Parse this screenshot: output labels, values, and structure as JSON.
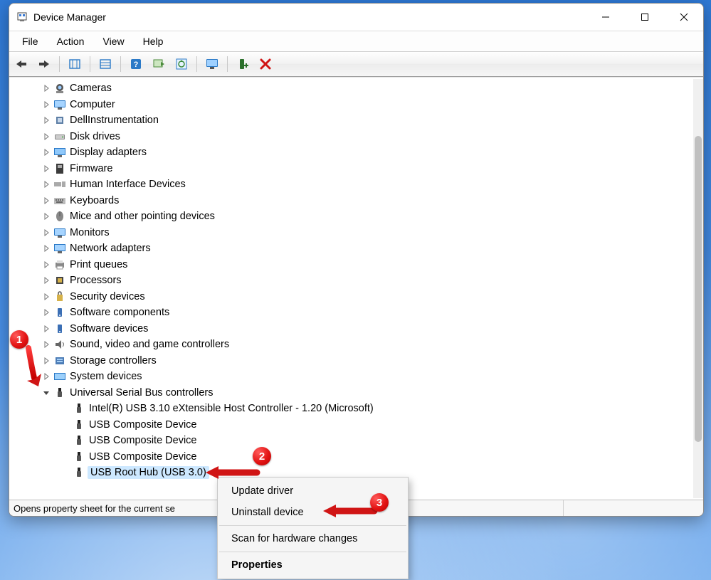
{
  "window": {
    "title": "Device Manager"
  },
  "menubar": [
    "File",
    "Action",
    "View",
    "Help"
  ],
  "toolbar_buttons": [
    {
      "name": "back"
    },
    {
      "name": "forward"
    },
    {
      "sep": true
    },
    {
      "name": "show-hidden"
    },
    {
      "sep": true
    },
    {
      "name": "properties"
    },
    {
      "sep": true
    },
    {
      "name": "help"
    },
    {
      "name": "scan"
    },
    {
      "name": "update"
    },
    {
      "sep": true
    },
    {
      "name": "monitor"
    },
    {
      "sep": true
    },
    {
      "name": "add-device"
    },
    {
      "name": "remove"
    }
  ],
  "tree": [
    {
      "level": 1,
      "expanded": false,
      "icon": "camera",
      "label": "Cameras"
    },
    {
      "level": 1,
      "expanded": false,
      "icon": "monitor",
      "label": "Computer"
    },
    {
      "level": 1,
      "expanded": false,
      "icon": "chip",
      "label": "DellInstrumentation"
    },
    {
      "level": 1,
      "expanded": false,
      "icon": "disk",
      "label": "Disk drives"
    },
    {
      "level": 1,
      "expanded": false,
      "icon": "display",
      "label": "Display adapters"
    },
    {
      "level": 1,
      "expanded": false,
      "icon": "firmware",
      "label": "Firmware"
    },
    {
      "level": 1,
      "expanded": false,
      "icon": "hid",
      "label": "Human Interface Devices"
    },
    {
      "level": 1,
      "expanded": false,
      "icon": "keyboard",
      "label": "Keyboards"
    },
    {
      "level": 1,
      "expanded": false,
      "icon": "mouse",
      "label": "Mice and other pointing devices"
    },
    {
      "level": 1,
      "expanded": false,
      "icon": "monitor",
      "label": "Monitors"
    },
    {
      "level": 1,
      "expanded": false,
      "icon": "network",
      "label": "Network adapters"
    },
    {
      "level": 1,
      "expanded": false,
      "icon": "printer",
      "label": "Print queues"
    },
    {
      "level": 1,
      "expanded": false,
      "icon": "cpu",
      "label": "Processors"
    },
    {
      "level": 1,
      "expanded": false,
      "icon": "security",
      "label": "Security devices"
    },
    {
      "level": 1,
      "expanded": false,
      "icon": "software",
      "label": "Software components"
    },
    {
      "level": 1,
      "expanded": false,
      "icon": "software",
      "label": "Software devices"
    },
    {
      "level": 1,
      "expanded": false,
      "icon": "audio",
      "label": "Sound, video and game controllers"
    },
    {
      "level": 1,
      "expanded": false,
      "icon": "storage",
      "label": "Storage controllers"
    },
    {
      "level": 1,
      "expanded": false,
      "icon": "system",
      "label": "System devices"
    },
    {
      "level": 1,
      "expanded": true,
      "icon": "usb",
      "label": "Universal Serial Bus controllers"
    },
    {
      "level": 2,
      "icon": "usb",
      "label": "Intel(R) USB 3.10 eXtensible Host Controller - 1.20 (Microsoft)"
    },
    {
      "level": 2,
      "icon": "usb",
      "label": "USB Composite Device"
    },
    {
      "level": 2,
      "icon": "usb",
      "label": "USB Composite Device"
    },
    {
      "level": 2,
      "icon": "usb",
      "label": "USB Composite Device"
    },
    {
      "level": 2,
      "icon": "usb",
      "label": "USB Root Hub (USB 3.0)",
      "selected": true
    }
  ],
  "context_menu": [
    {
      "label": "Update driver"
    },
    {
      "label": "Uninstall device"
    },
    {
      "div": true
    },
    {
      "label": "Scan for hardware changes"
    },
    {
      "div": true
    },
    {
      "label": "Properties",
      "bold": true
    }
  ],
  "statusbar": {
    "text": "Opens property sheet for the current se"
  },
  "annotations": {
    "badge1": "1",
    "badge2": "2",
    "badge3": "3"
  }
}
